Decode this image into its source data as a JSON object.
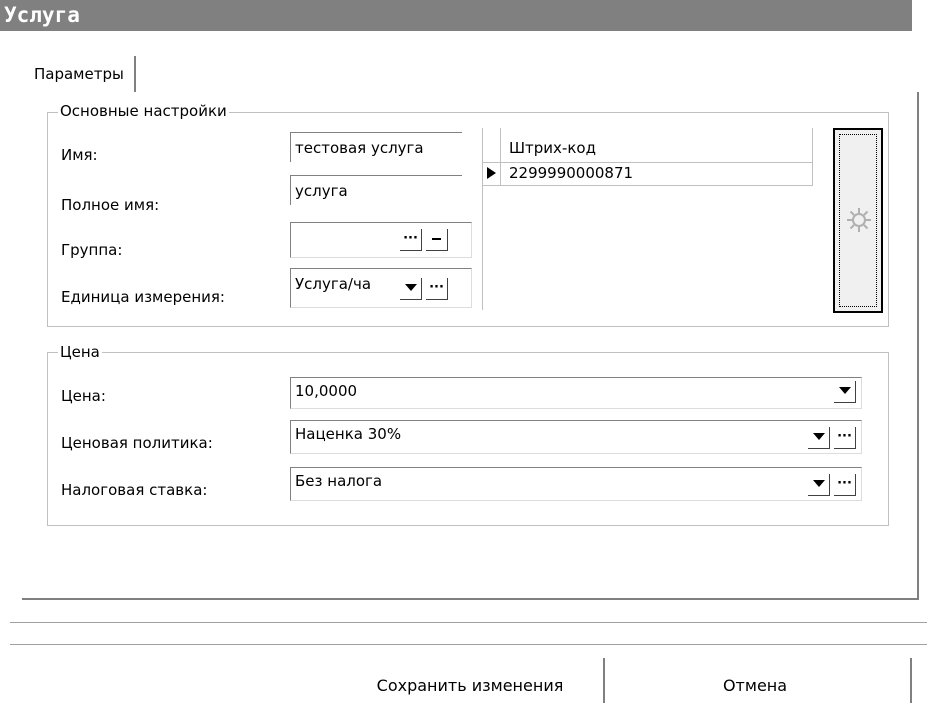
{
  "window": {
    "title": "Услуга"
  },
  "tabs": [
    {
      "label": "Параметры"
    }
  ],
  "basic_settings": {
    "legend": "Основные настройки",
    "name_label": "Имя:",
    "name_value": "тестовая услуга",
    "full_name_label": "Полное имя:",
    "full_name_value": "услуга",
    "group_label": "Группа:",
    "group_value": "",
    "unit_label": "Единица измерения:",
    "unit_value": "Услуга/ча"
  },
  "barcode_grid": {
    "column_header": "Штрих-код",
    "rows": [
      {
        "barcode": "2299990000871"
      }
    ]
  },
  "price_group": {
    "legend": "Цена",
    "price_label": "Цена:",
    "price_value": "10,0000",
    "policy_label": "Ценовая политика:",
    "policy_value": "Наценка 30%",
    "tax_label": "Налоговая ставка:",
    "tax_value": "Без налога"
  },
  "footer": {
    "save_label": "Сохранить изменения",
    "cancel_label": "Отмена"
  },
  "icons": {
    "ellipsis": "…",
    "dropdown": "chevron-down",
    "clear": "dash",
    "row_pointer": "triangle-right",
    "gear": "gear-icon"
  }
}
